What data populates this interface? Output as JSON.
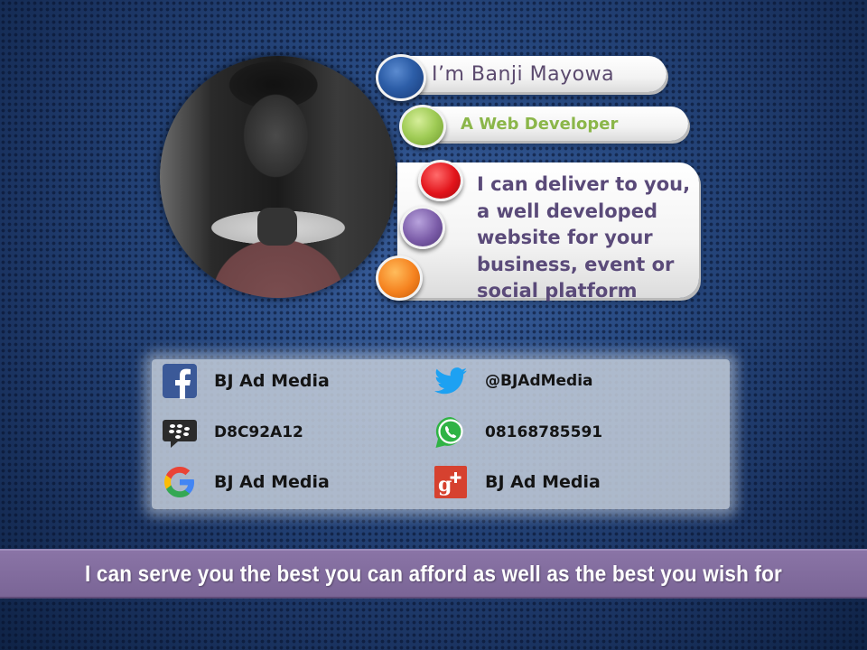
{
  "profile": {
    "name_line": "I’m Banji Mayowa",
    "role_line": "A Web Developer",
    "description": "I can deliver to you, a well developed website for your business, event or social platform"
  },
  "contacts": [
    {
      "network": "facebook",
      "icon": "facebook-icon",
      "label": "BJ Ad Media"
    },
    {
      "network": "twitter",
      "icon": "twitter-icon",
      "label": "@BJAdMedia"
    },
    {
      "network": "blackberry",
      "icon": "bbm-icon",
      "label": "D8C92A12"
    },
    {
      "network": "whatsapp",
      "icon": "whatsapp-icon",
      "label": "08168785591"
    },
    {
      "network": "google",
      "icon": "google-icon",
      "label": "BJ Ad Media"
    },
    {
      "network": "googleplus",
      "icon": "google-plus-icon",
      "label": "BJ Ad Media"
    }
  ],
  "footer": {
    "tagline": "I can serve you the best you can afford as well as the best you wish for"
  },
  "colors": {
    "background": "#1d3563",
    "footer_band": "#7a6596",
    "name_text": "#5b4a6e",
    "role_text": "#8bb649",
    "description_text": "#5a4a79"
  }
}
